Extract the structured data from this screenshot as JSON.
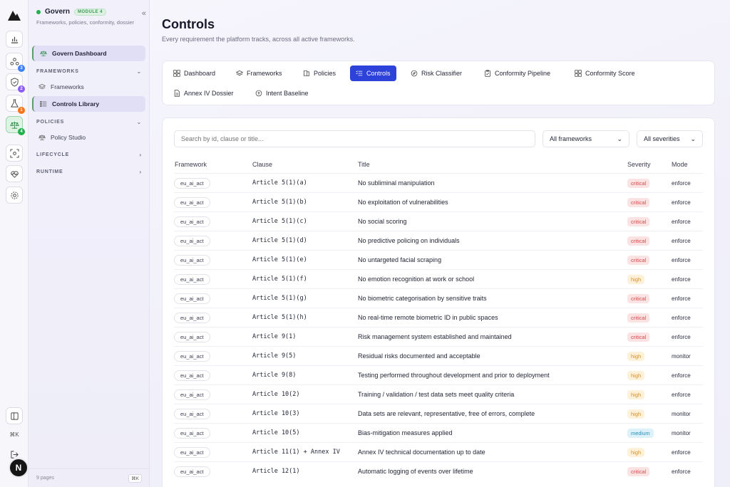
{
  "sidebar": {
    "title": "Govern",
    "module_badge": "MODULE 4",
    "subtitle": "Frameworks, policies, conformity, dossier",
    "dashboard_label": "Govern Dashboard",
    "groups": {
      "frameworks": "FRAMEWORKS",
      "policies": "POLICIES",
      "lifecycle": "LIFECYCLE",
      "runtime": "RUNTIME"
    },
    "items": {
      "frameworks": "Frameworks",
      "controls_library": "Controls Library",
      "policy_studio": "Policy Studio"
    },
    "footer_pages": "9 pages",
    "footer_kbd": "⌘K"
  },
  "rail": {
    "badges": [
      "3",
      "2",
      "1",
      "4"
    ],
    "kbd": "⌘K",
    "avatar": "N"
  },
  "page": {
    "title": "Controls",
    "subtitle": "Every requirement the platform tracks, across all active frameworks."
  },
  "tabs": [
    "Dashboard",
    "Frameworks",
    "Policies",
    "Controls",
    "Risk Classifier",
    "Conformity Pipeline",
    "Conformity Score",
    "Annex IV Dossier",
    "Intent Baseline"
  ],
  "filters": {
    "search_placeholder": "Search by id, clause or title...",
    "framework": "All frameworks",
    "severity": "All severities"
  },
  "table": {
    "headers": [
      "Framework",
      "Clause",
      "Title",
      "Severity",
      "Mode"
    ],
    "rows": [
      {
        "framework": "eu_ai_act",
        "clause": "Article 5(1)(a)",
        "title": "No subliminal manipulation",
        "severity": "critical",
        "mode": "enforce"
      },
      {
        "framework": "eu_ai_act",
        "clause": "Article 5(1)(b)",
        "title": "No exploitation of vulnerabilities",
        "severity": "critical",
        "mode": "enforce"
      },
      {
        "framework": "eu_ai_act",
        "clause": "Article 5(1)(c)",
        "title": "No social scoring",
        "severity": "critical",
        "mode": "enforce"
      },
      {
        "framework": "eu_ai_act",
        "clause": "Article 5(1)(d)",
        "title": "No predictive policing on individuals",
        "severity": "critical",
        "mode": "enforce"
      },
      {
        "framework": "eu_ai_act",
        "clause": "Article 5(1)(e)",
        "title": "No untargeted facial scraping",
        "severity": "critical",
        "mode": "enforce"
      },
      {
        "framework": "eu_ai_act",
        "clause": "Article 5(1)(f)",
        "title": "No emotion recognition at work or school",
        "severity": "high",
        "mode": "enforce"
      },
      {
        "framework": "eu_ai_act",
        "clause": "Article 5(1)(g)",
        "title": "No biometric categorisation by sensitive traits",
        "severity": "critical",
        "mode": "enforce"
      },
      {
        "framework": "eu_ai_act",
        "clause": "Article 5(1)(h)",
        "title": "No real-time remote biometric ID in public spaces",
        "severity": "critical",
        "mode": "enforce"
      },
      {
        "framework": "eu_ai_act",
        "clause": "Article 9(1)",
        "title": "Risk management system established and maintained",
        "severity": "critical",
        "mode": "enforce"
      },
      {
        "framework": "eu_ai_act",
        "clause": "Article 9(5)",
        "title": "Residual risks documented and acceptable",
        "severity": "high",
        "mode": "monitor"
      },
      {
        "framework": "eu_ai_act",
        "clause": "Article 9(8)",
        "title": "Testing performed throughout development and prior to deployment",
        "severity": "high",
        "mode": "enforce"
      },
      {
        "framework": "eu_ai_act",
        "clause": "Article 10(2)",
        "title": "Training / validation / test data sets meet quality criteria",
        "severity": "high",
        "mode": "enforce"
      },
      {
        "framework": "eu_ai_act",
        "clause": "Article 10(3)",
        "title": "Data sets are relevant, representative, free of errors, complete",
        "severity": "high",
        "mode": "monitor"
      },
      {
        "framework": "eu_ai_act",
        "clause": "Article 10(5)",
        "title": "Bias-mitigation measures applied",
        "severity": "medium",
        "mode": "monitor"
      },
      {
        "framework": "eu_ai_act",
        "clause": "Article 11(1) + Annex IV",
        "title": "Annex IV technical documentation up to date",
        "severity": "high",
        "mode": "enforce"
      },
      {
        "framework": "eu_ai_act",
        "clause": "Article 12(1)",
        "title": "Automatic logging of events over lifetime",
        "severity": "critical",
        "mode": "enforce"
      }
    ]
  },
  "colors": {
    "accent": "#2c42d8",
    "active_green": "#22b04b",
    "critical": "#d04a4a",
    "high": "#d9902c",
    "medium": "#2c8fbd"
  }
}
